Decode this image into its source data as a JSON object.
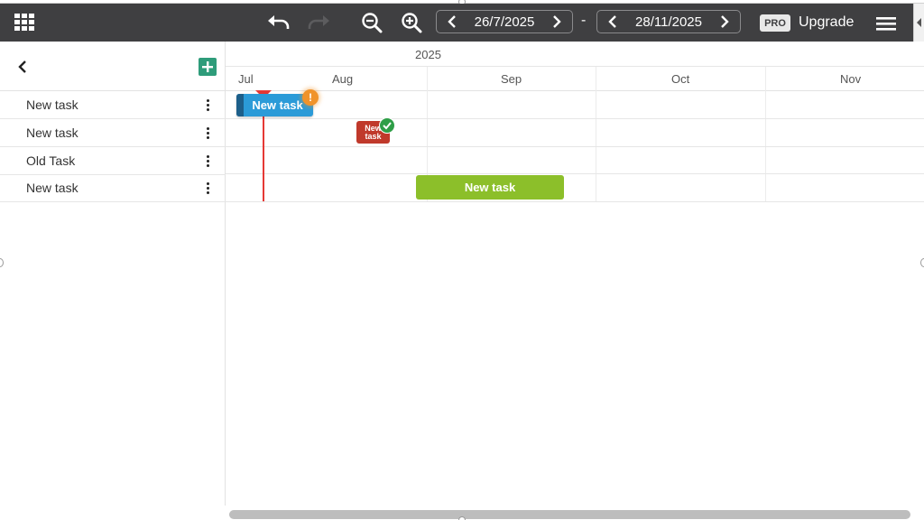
{
  "toolbar": {
    "date_start": "26/7/2025",
    "date_separator": "-",
    "date_end": "28/11/2025",
    "pro_badge": "PRO",
    "upgrade_label": "Upgrade",
    "icons": {
      "apps": "grid-icon",
      "undo": "undo-icon",
      "redo": "redo-icon",
      "zoom_out": "zoom-out-icon",
      "zoom_in": "zoom-in-icon",
      "menu": "hamburger-icon"
    }
  },
  "tasks": [
    {
      "name": "New task"
    },
    {
      "name": "New task"
    },
    {
      "name": "Old Task"
    },
    {
      "name": "New task"
    }
  ],
  "timeline": {
    "year": "2025",
    "months": [
      "Jul",
      "Aug",
      "Sep",
      "Oct",
      "Nov"
    ],
    "bars": [
      {
        "label": "New task",
        "color": "#2b9bd8",
        "status": "warning"
      },
      {
        "label": "New task",
        "color": "#c0392b",
        "status": "done"
      },
      {
        "label": "New task",
        "color": "#8cbf2a",
        "status": ""
      }
    ],
    "warning_glyph": "!",
    "today_color": "#e53935"
  },
  "colors": {
    "toolbar_bg": "#3f3f41",
    "add_button": "#2e9c7a"
  }
}
